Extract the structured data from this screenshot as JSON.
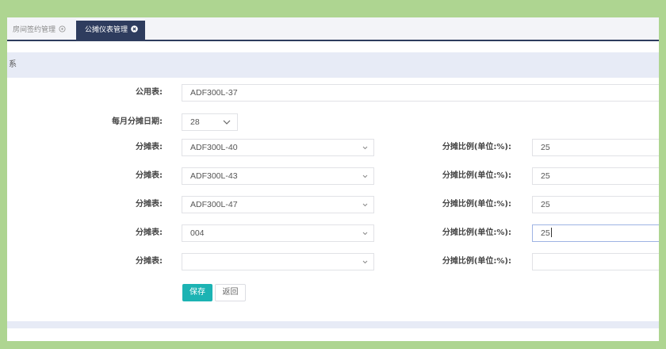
{
  "tabs": [
    {
      "label": "房间签约管理",
      "icon": "circle-dot-icon",
      "active": false
    },
    {
      "label": "公摊仪表管理",
      "icon": "close-circle-icon",
      "active": true
    }
  ],
  "section": {
    "title": "系"
  },
  "form": {
    "public_meter": {
      "label": "公用表:",
      "value": "ADF300L-37"
    },
    "monthly_date": {
      "label": "每月分摊日期:",
      "value": "28"
    },
    "rows": [
      {
        "meter_label": "分摊表:",
        "meter_value": "ADF300L-40",
        "ratio_label": "分摊比例(单位:%):",
        "ratio_value": "25"
      },
      {
        "meter_label": "分摊表:",
        "meter_value": "ADF300L-43",
        "ratio_label": "分摊比例(单位:%):",
        "ratio_value": "25"
      },
      {
        "meter_label": "分摊表:",
        "meter_value": "ADF300L-47",
        "ratio_label": "分摊比例(单位:%):",
        "ratio_value": "25"
      },
      {
        "meter_label": "分摊表:",
        "meter_value": "004",
        "ratio_label": "分摊比例(单位:%):",
        "ratio_value": "25"
      },
      {
        "meter_label": "分摊表:",
        "meter_value": "",
        "ratio_label": "分摊比例(单位:%):",
        "ratio_value": ""
      }
    ]
  },
  "buttons": {
    "save": "保存",
    "back": "返回"
  },
  "colors": {
    "frame": "#aed591",
    "tab_active": "#2e3c5e",
    "header_bg": "#e7ebf6",
    "accent": "#1cb3b3",
    "focus": "#9fb4e4"
  }
}
